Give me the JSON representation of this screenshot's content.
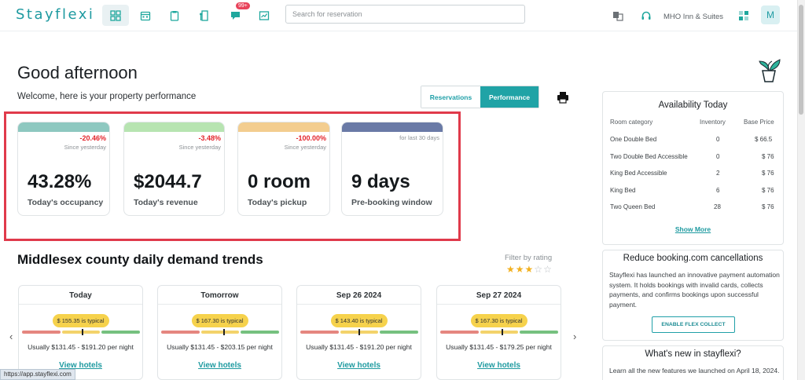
{
  "brand": "Stayflexi",
  "nav": {
    "notification_count": "99+",
    "search_placeholder": "Search for reservation",
    "hotel_name": "MHO Inn & Suites",
    "avatar_initial": "M"
  },
  "greeting": {
    "title": "Good afternoon",
    "subtitle": "Welcome, here is your property performance",
    "toggle_reservations": "Reservations",
    "toggle_performance": "Performance"
  },
  "kpis": [
    {
      "change": "-20.46%",
      "since": "Since yesterday",
      "value": "43.28%",
      "label": "Today's occupancy",
      "band_color": "#8ec8c0"
    },
    {
      "change": "-3.48%",
      "since": "Since yesterday",
      "value": "$2044.7",
      "label": "Today's revenue",
      "band_color": "#b7e4b1"
    },
    {
      "change": "-100.00%",
      "since": "Since yesterday",
      "value": "0 room",
      "label": "Today's pickup",
      "band_color": "#f3cd8f"
    },
    {
      "change": "",
      "since": "for last 30 days",
      "value": "9 days",
      "label": "Pre-booking window",
      "band_color": "#6a7aa6"
    }
  ],
  "demand": {
    "title": "Middlesex county daily demand trends",
    "filter_label": "Filter by rating",
    "rating": 3,
    "rating_max": 5,
    "view_hotels": "View hotels",
    "days": [
      {
        "name": "Today",
        "typical": "$ 155.35 is typical",
        "range": "Usually $131.45 - $191.20 per night"
      },
      {
        "name": "Tomorrow",
        "typical": "$ 167.30 is typical",
        "range": "Usually $131.45 - $203.15 per night"
      },
      {
        "name": "Sep 26 2024",
        "typical": "$ 143.40 is typical",
        "range": "Usually $131.45 - $191.20 per night"
      },
      {
        "name": "Sep 27 2024",
        "typical": "$ 167.30 is typical",
        "range": "Usually $131.45 - $179.25 per night"
      }
    ]
  },
  "availability": {
    "title": "Availability Today",
    "headers": {
      "category": "Room category",
      "inventory": "Inventory",
      "price": "Base Price"
    },
    "rows": [
      {
        "category": "One Double Bed",
        "inventory": "0",
        "price": "$ 66.5"
      },
      {
        "category": "Two Double Bed Accessible",
        "inventory": "0",
        "price": "$ 76"
      },
      {
        "category": "King Bed Accessible",
        "inventory": "2",
        "price": "$ 76"
      },
      {
        "category": "King Bed",
        "inventory": "6",
        "price": "$ 76"
      },
      {
        "category": "Two Queen Bed",
        "inventory": "28",
        "price": "$ 76"
      }
    ],
    "show_more": "Show More"
  },
  "flex_collect": {
    "title": "Reduce booking.com cancellations",
    "body": "Stayflexi has launched an innovative payment automation system. It holds bookings with invalid cards, collects payments, and confirms bookings upon successful payment.",
    "button": "ENABLE FLEX COLLECT"
  },
  "whats_new": {
    "title": "What's new in stayflexi?",
    "body": "Learn all the new features we launched on April 18, 2024."
  },
  "status_url": "https://app.stayflexi.com",
  "colors": {
    "accent": "#20a3a6",
    "negative": "#e3242b",
    "highlight_border": "#e03a4b",
    "typical_pill": "#f6d24c"
  }
}
